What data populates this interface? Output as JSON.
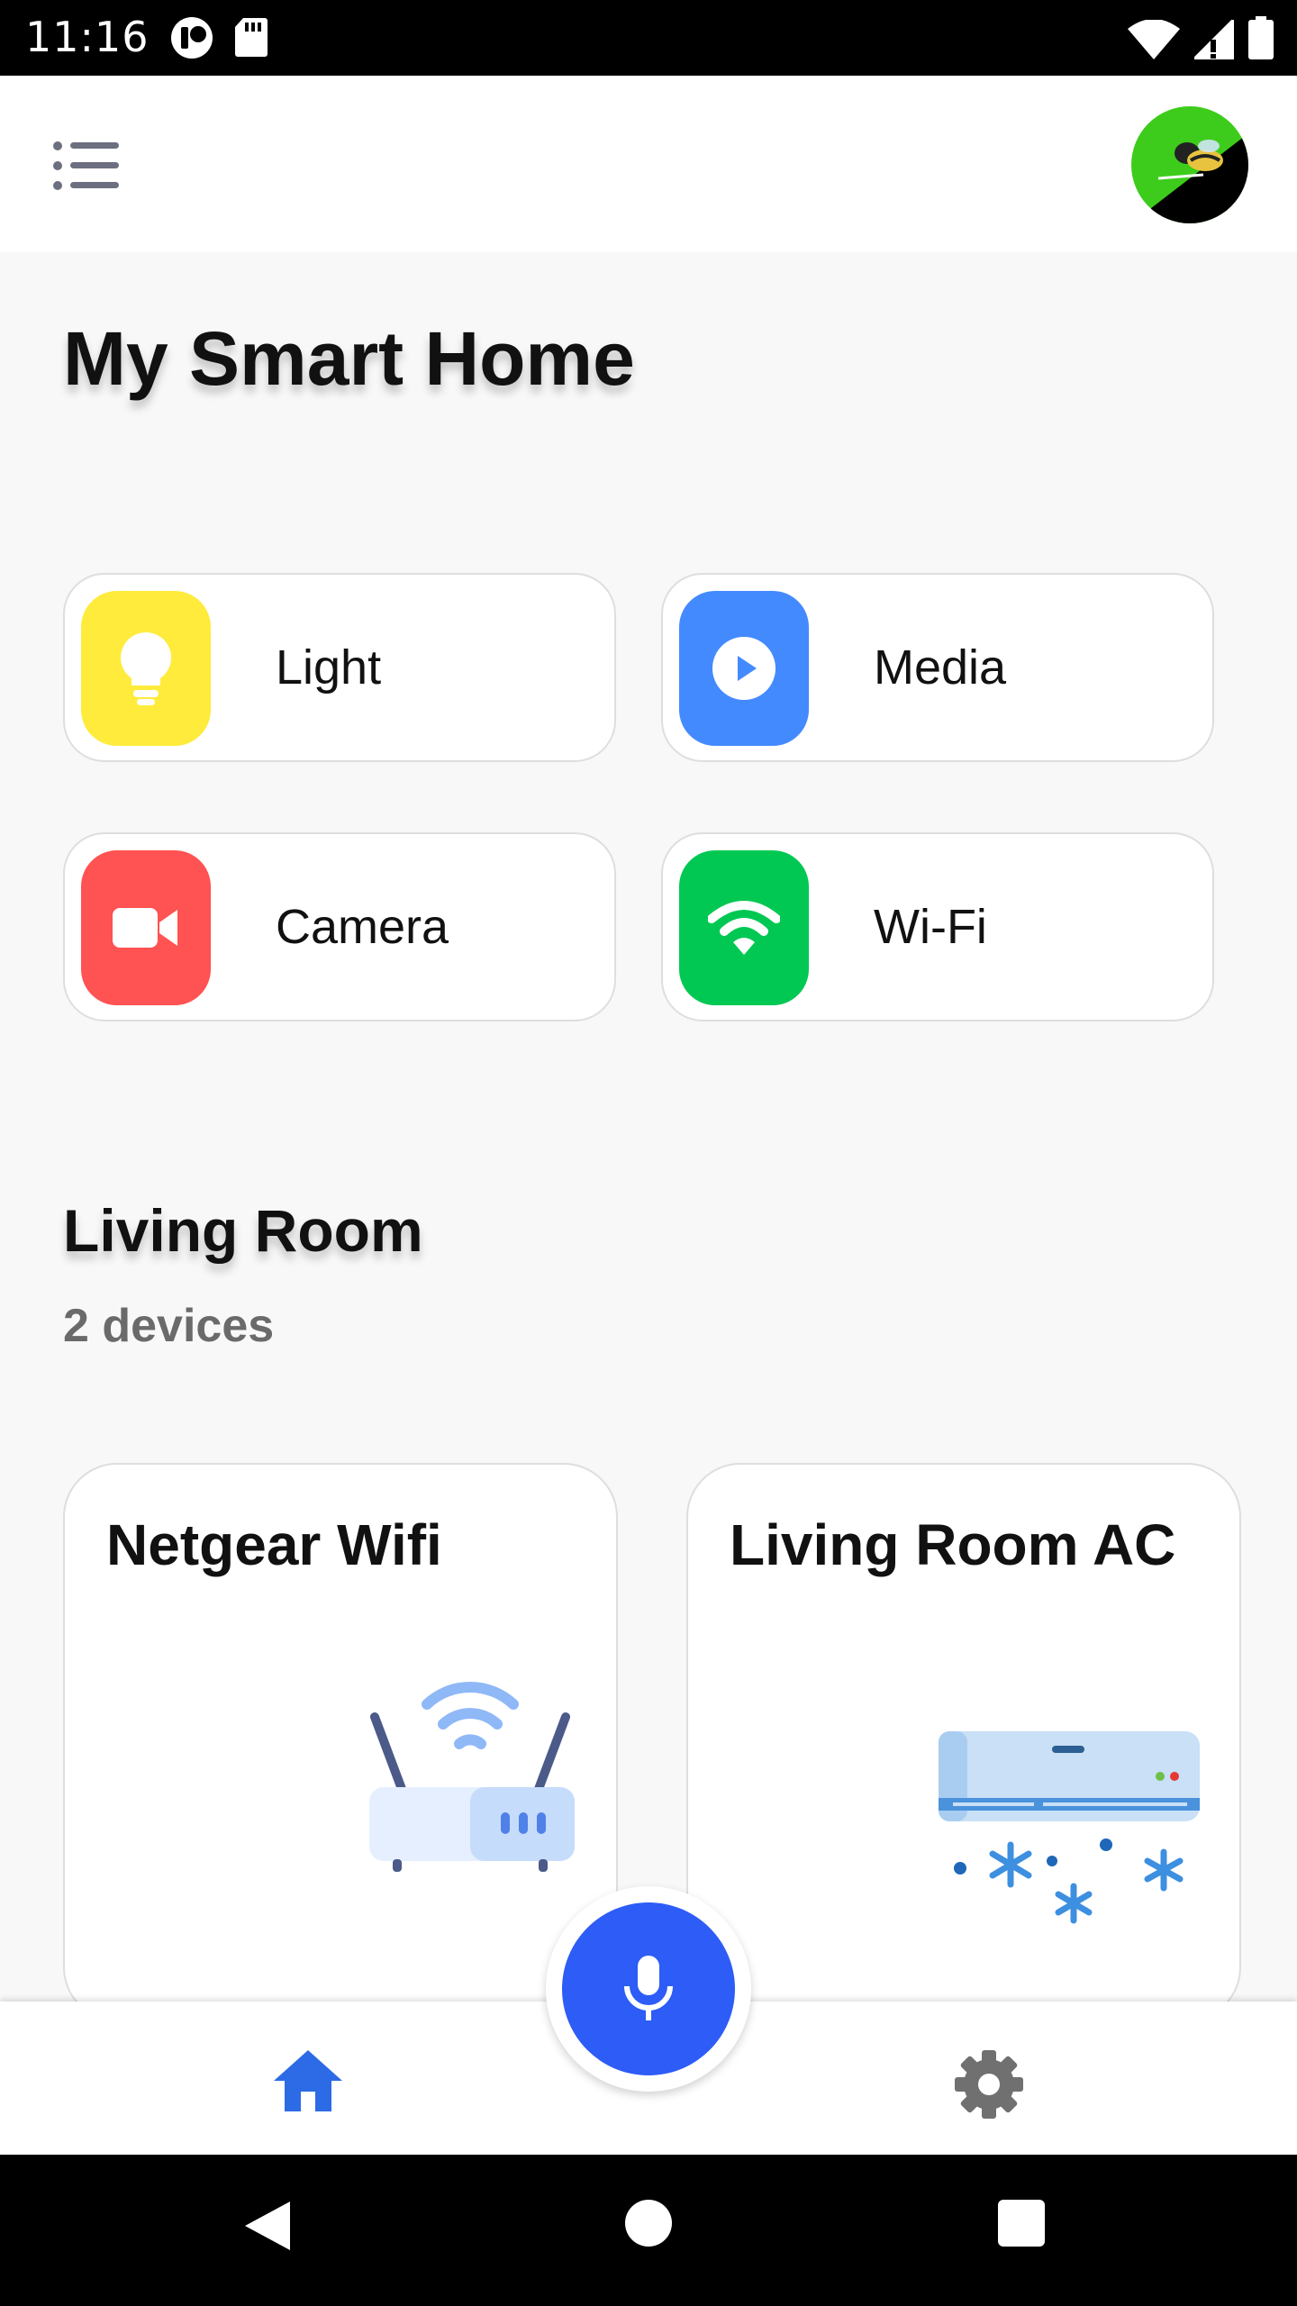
{
  "status_bar": {
    "time": "11:16",
    "icons": [
      "notification-icon",
      "sd-card-icon",
      "wifi-icon",
      "signal-icon",
      "battery-icon"
    ]
  },
  "app_bar": {
    "menu_icon": "menu-list-icon",
    "avatar": "user-avatar"
  },
  "page": {
    "title": "My Smart Home"
  },
  "categories": [
    {
      "label": "Light",
      "icon": "lightbulb-icon",
      "color": "#ffeb3b"
    },
    {
      "label": "Media",
      "icon": "play-icon",
      "color": "#448aff"
    },
    {
      "label": "Camera",
      "icon": "video-camera-icon",
      "color": "#ff5252"
    },
    {
      "label": "Wi-Fi",
      "icon": "wifi-icon",
      "color": "#00c853"
    }
  ],
  "room": {
    "title": "Living Room",
    "subtitle": "2 devices",
    "devices": [
      {
        "name": "Netgear Wifi",
        "icon": "router-icon"
      },
      {
        "name": "Living Room AC",
        "icon": "air-conditioner-icon"
      }
    ]
  },
  "bottom_nav": {
    "home_icon": "home-icon",
    "mic_icon": "microphone-icon",
    "settings_icon": "settings-gear-icon",
    "accent": "#2d5cf6"
  }
}
